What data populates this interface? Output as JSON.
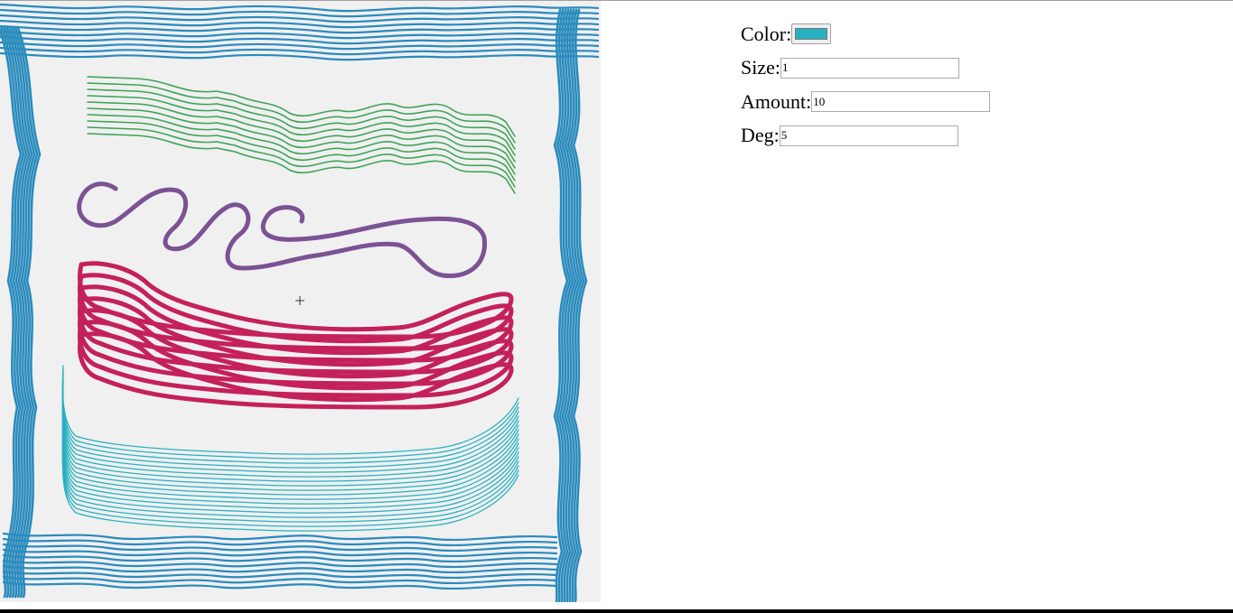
{
  "controls": {
    "color": {
      "label": "Color:",
      "value": "#26b1c0"
    },
    "size": {
      "label": "Size:",
      "value": "1"
    },
    "amount": {
      "label": "Amount:",
      "value": "10"
    },
    "deg": {
      "label": "Deg:",
      "value": "5"
    }
  },
  "canvas": {
    "background": "#f0f0f0",
    "cursor_icon": "crosshair-icon",
    "strokes": [
      {
        "name": "blue-frame",
        "color": "#2a8bbd"
      },
      {
        "name": "green-wave",
        "color": "#3ea357"
      },
      {
        "name": "purple-squiggle",
        "color": "#7b5293"
      },
      {
        "name": "crimson-loop",
        "color": "#c4215a"
      },
      {
        "name": "cyan-bowl",
        "color": "#26b1c0"
      }
    ]
  }
}
